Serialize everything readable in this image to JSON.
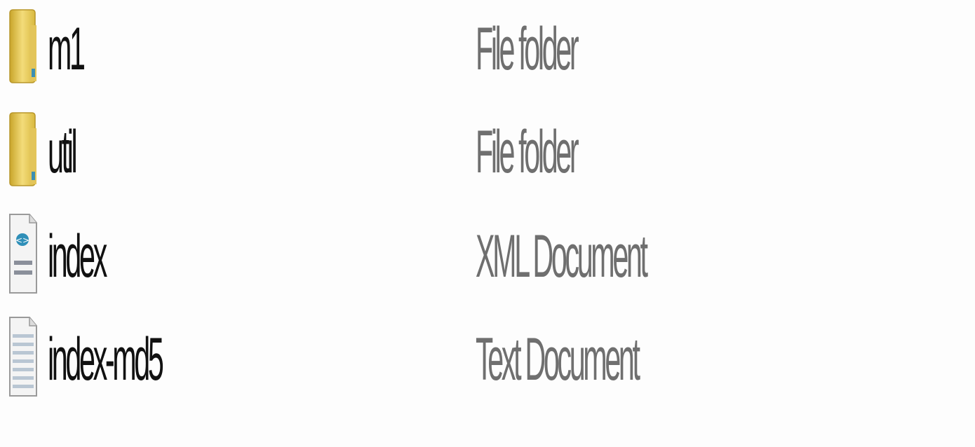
{
  "file_list": {
    "items": [
      {
        "name": "m1",
        "type": "File folder",
        "icon": "folder-icon"
      },
      {
        "name": "util",
        "type": "File folder",
        "icon": "folder-icon"
      },
      {
        "name": "index",
        "type": "XML Document",
        "icon": "xml-document-icon"
      },
      {
        "name": "index-md5",
        "type": "Text Document",
        "icon": "text-document-icon"
      }
    ]
  },
  "colors": {
    "background": "#fdfdfd",
    "name_text": "#111111",
    "type_text": "#6f6f6f",
    "folder": "#e8c94f"
  }
}
